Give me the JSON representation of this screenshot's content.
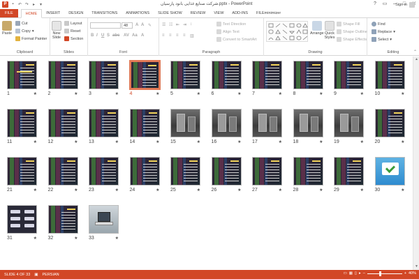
{
  "window": {
    "title": "شرکت صنایع غذایی بانود پارسیان.pptx - PowerPoint",
    "controls": [
      "?",
      "▭",
      "–",
      "□",
      "✕"
    ]
  },
  "tabs": [
    {
      "label": "FILE",
      "kind": "file"
    },
    {
      "label": "HOME",
      "kind": "active"
    },
    {
      "label": "INSERT"
    },
    {
      "label": "DESIGN"
    },
    {
      "label": "TRANSITIONS"
    },
    {
      "label": "ANIMATIONS"
    },
    {
      "label": "SLIDE SHOW"
    },
    {
      "label": "REVIEW"
    },
    {
      "label": "VIEW"
    },
    {
      "label": "ADD-INS"
    },
    {
      "label": "FILEminimizer"
    }
  ],
  "account": {
    "signin": "Sign in"
  },
  "ribbon": {
    "clipboard": {
      "paste": "Paste",
      "cut": "Cut",
      "copy": "Copy",
      "format_painter": "Format Painter",
      "label": "Clipboard"
    },
    "slides": {
      "new_slide": "New Slide",
      "layout": "Layout",
      "reset": "Reset",
      "section": "Section",
      "label": "Slides"
    },
    "font": {
      "font_name": "",
      "font_size": "48",
      "label": "Font"
    },
    "paragraph": {
      "text_direction": "Text Direction",
      "align_text": "Align Text",
      "smartart": "Convert to SmartArt",
      "label": "Paragraph"
    },
    "drawing": {
      "arrange": "Arrange",
      "quick_styles": "Quick Styles",
      "shape_fill": "Shape Fill",
      "shape_outline": "Shape Outline",
      "shape_effects": "Shape Effects",
      "label": "Drawing"
    },
    "editing": {
      "find": "Find",
      "replace": "Replace",
      "select": "Select",
      "label": "Editing"
    }
  },
  "slides": [
    {
      "n": "1",
      "kind": "dark",
      "title": true
    },
    {
      "n": "2",
      "kind": "dark"
    },
    {
      "n": "3",
      "kind": "dark"
    },
    {
      "n": "4",
      "kind": "dark",
      "selected": true
    },
    {
      "n": "5",
      "kind": "dark"
    },
    {
      "n": "6",
      "kind": "dark"
    },
    {
      "n": "7",
      "kind": "dark"
    },
    {
      "n": "8",
      "kind": "dark"
    },
    {
      "n": "9",
      "kind": "dark"
    },
    {
      "n": "10",
      "kind": "dark"
    },
    {
      "n": "11",
      "kind": "dark"
    },
    {
      "n": "12",
      "kind": "dark"
    },
    {
      "n": "13",
      "kind": "dark"
    },
    {
      "n": "14",
      "kind": "dark"
    },
    {
      "n": "15",
      "kind": "photo"
    },
    {
      "n": "16",
      "kind": "photo"
    },
    {
      "n": "17",
      "kind": "photo"
    },
    {
      "n": "18",
      "kind": "photo"
    },
    {
      "n": "19",
      "kind": "photo"
    },
    {
      "n": "20",
      "kind": "dark"
    },
    {
      "n": "21",
      "kind": "dark"
    },
    {
      "n": "22",
      "kind": "dark"
    },
    {
      "n": "23",
      "kind": "dark"
    },
    {
      "n": "24",
      "kind": "dark"
    },
    {
      "n": "25",
      "kind": "dark"
    },
    {
      "n": "26",
      "kind": "dark"
    },
    {
      "n": "27",
      "kind": "dark"
    },
    {
      "n": "28",
      "kind": "dark"
    },
    {
      "n": "29",
      "kind": "dark"
    },
    {
      "n": "30",
      "kind": "logo"
    },
    {
      "n": "31",
      "kind": "diagram"
    },
    {
      "n": "32",
      "kind": "dark"
    },
    {
      "n": "33",
      "kind": "laptop"
    }
  ],
  "status": {
    "slide": "SLIDE 4 OF 33",
    "language": "PERSIAN",
    "zoom": "40%"
  },
  "colors": {
    "accent": "#d24726",
    "selected_border": "#e27a56"
  }
}
